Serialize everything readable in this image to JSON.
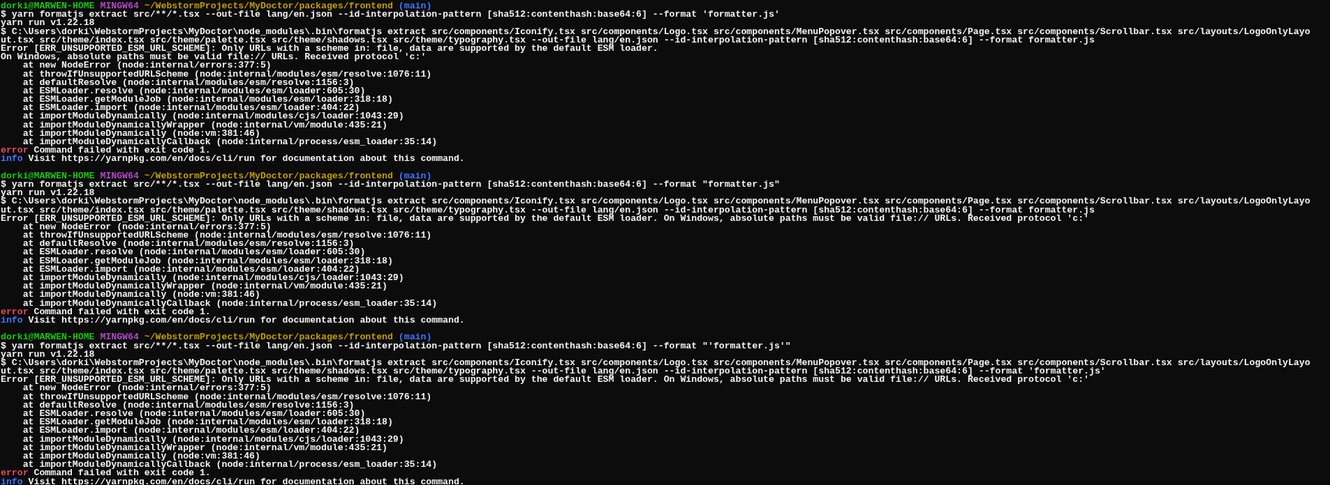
{
  "terminal": {
    "blocks": [
      {
        "prompt": {
          "user_host": "dorki@MARWEN-HOME",
          "shell": "MINGW64",
          "path": "~/WebstormProjects/MyDoctor/packages/frontend",
          "branch": "(main)"
        },
        "lines": [
          {
            "kind": "text",
            "text": "$ yarn formatjs extract src/**/*.tsx --out-file lang/en.json --id-interpolation-pattern [sha512:contenthash:base64:6] --format 'formatter.js'"
          },
          {
            "kind": "text",
            "text": "yarn run v1.22.18"
          },
          {
            "kind": "text",
            "text": "$ C:\\Users\\dorki\\WebstormProjects\\MyDoctor\\node_modules\\.bin\\formatjs extract src/components/Iconify.tsx src/components/Logo.tsx src/components/MenuPopover.tsx src/components/Page.tsx src/components/Scrollbar.tsx src/layouts/LogoOnlyLayo"
          },
          {
            "kind": "text",
            "text": "ut.tsx src/theme/index.tsx src/theme/palette.tsx src/theme/shadows.tsx src/theme/typography.tsx --out-file lang/en.json --id-interpolation-pattern [sha512:contenthash:base64:6] --format formatter.js"
          },
          {
            "kind": "text",
            "text": "Error [ERR_UNSUPPORTED_ESM_URL_SCHEME]: Only URLs with a scheme in: file, data are supported by the default ESM loader."
          },
          {
            "kind": "text",
            "text": "On Windows, absolute paths must be valid file:// URLs. Received protocol 'c:'"
          },
          {
            "kind": "trace",
            "text": "at new NodeError (node:internal/errors:377:5)"
          },
          {
            "kind": "trace",
            "text": "at throwIfUnsupportedURLScheme (node:internal/modules/esm/resolve:1076:11)"
          },
          {
            "kind": "trace",
            "text": "at defaultResolve (node:internal/modules/esm/resolve:1156:3)"
          },
          {
            "kind": "trace",
            "text": "at ESMLoader.resolve (node:internal/modules/esm/loader:605:30)"
          },
          {
            "kind": "trace",
            "text": "at ESMLoader.getModuleJob (node:internal/modules/esm/loader:318:18)"
          },
          {
            "kind": "trace",
            "text": "at ESMLoader.import (node:internal/modules/esm/loader:404:22)"
          },
          {
            "kind": "trace",
            "text": "at importModuleDynamically (node:internal/modules/cjs/loader:1043:29)"
          },
          {
            "kind": "trace",
            "text": "at importModuleDynamicallyWrapper (node:internal/vm/module:435:21)"
          },
          {
            "kind": "trace",
            "text": "at importModuleDynamically (node:vm:381:46)"
          },
          {
            "kind": "trace",
            "text": "at importModuleDynamicallyCallback (node:internal/process/esm_loader:35:14)"
          },
          {
            "kind": "error",
            "label": "error",
            "text": "Command failed with exit code 1."
          },
          {
            "kind": "info",
            "label": "info",
            "text": "Visit https://yarnpkg.com/en/docs/cli/run for documentation about this command."
          }
        ]
      },
      {
        "prompt": {
          "user_host": "dorki@MARWEN-HOME",
          "shell": "MINGW64",
          "path": "~/WebstormProjects/MyDoctor/packages/frontend",
          "branch": "(main)"
        },
        "lines": [
          {
            "kind": "text",
            "text": "$ yarn formatjs extract src/**/*.tsx --out-file lang/en.json --id-interpolation-pattern [sha512:contenthash:base64:6] --format \"formatter.js\""
          },
          {
            "kind": "text",
            "text": "yarn run v1.22.18"
          },
          {
            "kind": "text",
            "text": "$ C:\\Users\\dorki\\WebstormProjects\\MyDoctor\\node_modules\\.bin\\formatjs extract src/components/Iconify.tsx src/components/Logo.tsx src/components/MenuPopover.tsx src/components/Page.tsx src/components/Scrollbar.tsx src/layouts/LogoOnlyLayo"
          },
          {
            "kind": "text",
            "text": "ut.tsx src/theme/index.tsx src/theme/palette.tsx src/theme/shadows.tsx src/theme/typography.tsx --out-file lang/en.json --id-interpolation-pattern [sha512:contenthash:base64:6] --format formatter.js"
          },
          {
            "kind": "text",
            "text": "Error [ERR_UNSUPPORTED_ESM_URL_SCHEME]: Only URLs with a scheme in: file, data are supported by the default ESM loader. On Windows, absolute paths must be valid file:// URLs. Received protocol 'c:'"
          },
          {
            "kind": "trace",
            "text": "at new NodeError (node:internal/errors:377:5)"
          },
          {
            "kind": "trace",
            "text": "at throwIfUnsupportedURLScheme (node:internal/modules/esm/resolve:1076:11)"
          },
          {
            "kind": "trace",
            "text": "at defaultResolve (node:internal/modules/esm/resolve:1156:3)"
          },
          {
            "kind": "trace",
            "text": "at ESMLoader.resolve (node:internal/modules/esm/loader:605:30)"
          },
          {
            "kind": "trace",
            "text": "at ESMLoader.getModuleJob (node:internal/modules/esm/loader:318:18)"
          },
          {
            "kind": "trace",
            "text": "at ESMLoader.import (node:internal/modules/esm/loader:404:22)"
          },
          {
            "kind": "trace",
            "text": "at importModuleDynamically (node:internal/modules/cjs/loader:1043:29)"
          },
          {
            "kind": "trace",
            "text": "at importModuleDynamicallyWrapper (node:internal/vm/module:435:21)"
          },
          {
            "kind": "trace",
            "text": "at importModuleDynamically (node:vm:381:46)"
          },
          {
            "kind": "trace",
            "text": "at importModuleDynamicallyCallback (node:internal/process/esm_loader:35:14)"
          },
          {
            "kind": "error",
            "label": "error",
            "text": "Command failed with exit code 1."
          },
          {
            "kind": "info",
            "label": "info",
            "text": "Visit https://yarnpkg.com/en/docs/cli/run for documentation about this command."
          }
        ]
      },
      {
        "prompt": {
          "user_host": "dorki@MARWEN-HOME",
          "shell": "MINGW64",
          "path": "~/WebstormProjects/MyDoctor/packages/frontend",
          "branch": "(main)"
        },
        "lines": [
          {
            "kind": "text",
            "text": "$ yarn formatjs extract src/**/*.tsx --out-file lang/en.json --id-interpolation-pattern [sha512:contenthash:base64:6] --format \"'formatter.js'\""
          },
          {
            "kind": "text",
            "text": "yarn run v1.22.18"
          },
          {
            "kind": "text",
            "text": "$ C:\\Users\\dorki\\WebstormProjects\\MyDoctor\\node_modules\\.bin\\formatjs extract src/components/Iconify.tsx src/components/Logo.tsx src/components/MenuPopover.tsx src/components/Page.tsx src/components/Scrollbar.tsx src/layouts/LogoOnlyLayo"
          },
          {
            "kind": "text",
            "text": "ut.tsx src/theme/index.tsx src/theme/palette.tsx src/theme/shadows.tsx src/theme/typography.tsx --out-file lang/en.json --id-interpolation-pattern [sha512:contenthash:base64:6] --format 'formatter.js'"
          },
          {
            "kind": "text",
            "text": "Error [ERR_UNSUPPORTED_ESM_URL_SCHEME]: Only URLs with a scheme in: file, data are supported by the default ESM loader. On Windows, absolute paths must be valid file:// URLs. Received protocol 'c:'"
          },
          {
            "kind": "trace",
            "text": "at new NodeError (node:internal/errors:377:5)"
          },
          {
            "kind": "trace",
            "text": "at throwIfUnsupportedURLScheme (node:internal/modules/esm/resolve:1076:11)"
          },
          {
            "kind": "trace",
            "text": "at defaultResolve (node:internal/modules/esm/resolve:1156:3)"
          },
          {
            "kind": "trace",
            "text": "at ESMLoader.resolve (node:internal/modules/esm/loader:605:30)"
          },
          {
            "kind": "trace",
            "text": "at ESMLoader.getModuleJob (node:internal/modules/esm/loader:318:18)"
          },
          {
            "kind": "trace",
            "text": "at ESMLoader.import (node:internal/modules/esm/loader:404:22)"
          },
          {
            "kind": "trace",
            "text": "at importModuleDynamically (node:internal/modules/cjs/loader:1043:29)"
          },
          {
            "kind": "trace",
            "text": "at importModuleDynamicallyWrapper (node:internal/vm/module:435:21)"
          },
          {
            "kind": "trace",
            "text": "at importModuleDynamically (node:vm:381:46)"
          },
          {
            "kind": "trace",
            "text": "at importModuleDynamicallyCallback (node:internal/process/esm_loader:35:14)"
          },
          {
            "kind": "error",
            "label": "error",
            "text": "Command failed with exit code 1."
          },
          {
            "kind": "info",
            "label": "info",
            "text": "Visit https://yarnpkg.com/en/docs/cli/run for documentation about this command."
          }
        ]
      }
    ]
  }
}
